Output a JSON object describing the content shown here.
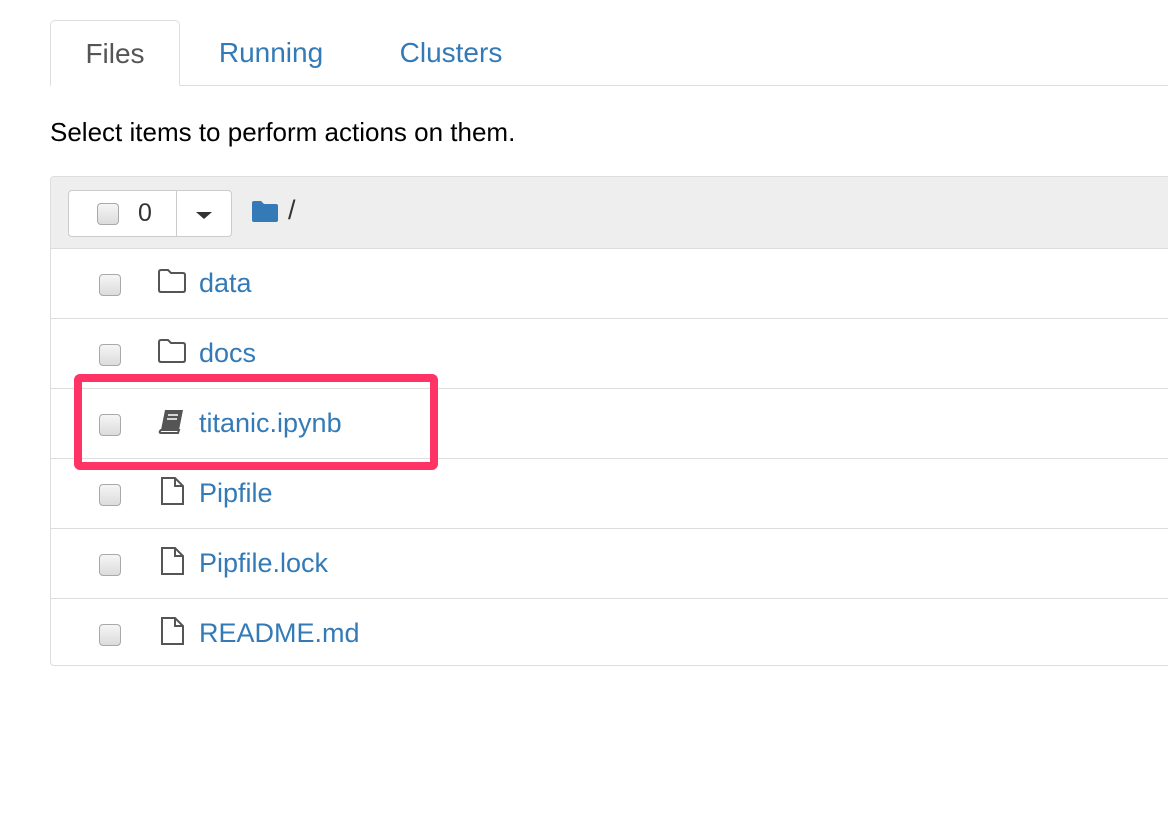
{
  "tabs": [
    {
      "label": "Files",
      "active": true
    },
    {
      "label": "Running",
      "active": false
    },
    {
      "label": "Clusters",
      "active": false
    }
  ],
  "instructions": "Select items to perform actions on them.",
  "toolbar": {
    "selected_count": "0",
    "breadcrumb_separator": "/"
  },
  "files": [
    {
      "name": "data",
      "type": "folder",
      "icon": "folder-icon"
    },
    {
      "name": "docs",
      "type": "folder",
      "icon": "folder-icon"
    },
    {
      "name": "titanic.ipynb",
      "type": "notebook",
      "icon": "notebook-icon"
    },
    {
      "name": "Pipfile",
      "type": "file",
      "icon": "file-icon"
    },
    {
      "name": "Pipfile.lock",
      "type": "file",
      "icon": "file-icon"
    },
    {
      "name": "README.md",
      "type": "file",
      "icon": "file-icon"
    }
  ],
  "colors": {
    "link": "#337ab7",
    "highlight": "#ff3366",
    "header_bg": "#eeeeee"
  }
}
